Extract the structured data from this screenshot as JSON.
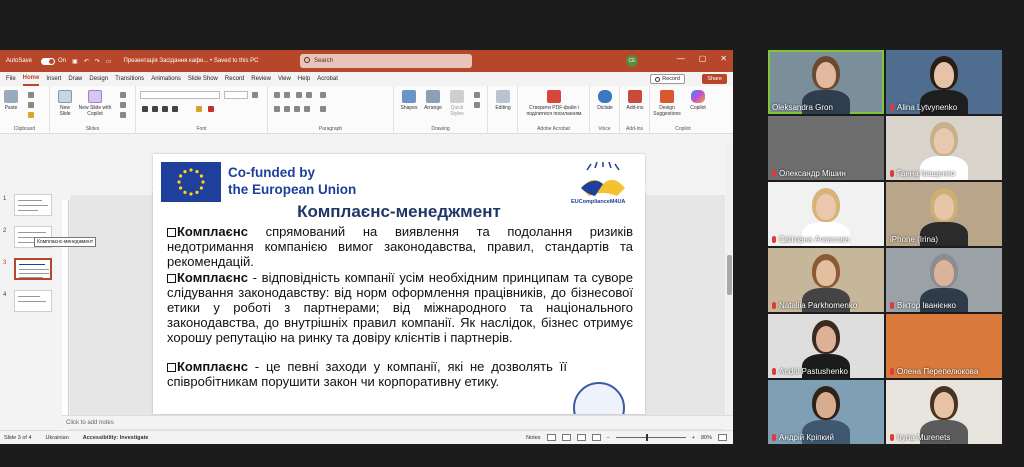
{
  "ppt": {
    "titlebar": {
      "autosave": "AutoSave",
      "toggle": "On",
      "doc_title": "Презентація Засідання кафе... • Saved to this PC",
      "search_placeholder": "Search",
      "user_initials": "CE",
      "controls": [
        "—",
        "▢",
        "✕"
      ]
    },
    "menu": [
      "File",
      "Home",
      "Insert",
      "Draw",
      "Design",
      "Transitions",
      "Animations",
      "Slide Show",
      "Record",
      "Review",
      "View",
      "Help",
      "Acrobat"
    ],
    "active_menu": "Home",
    "record_label": "Record",
    "share_label": "Share",
    "ribbon": {
      "groups": [
        "Clipboard",
        "Slides",
        "Font",
        "Paragraph",
        "Drawing",
        "Adobe Acrobat",
        "Voice",
        "Add-ins",
        "Copilot"
      ],
      "paste": "Paste",
      "new_slide": "New Slide",
      "new_slide_copilot": "New Slide with Copilot",
      "shapes": "Shapes",
      "arrange": "Arrange",
      "quick_styles": "Quick Styles",
      "editing": "Editing",
      "acrobat_action": "Створити PDF-файл і поділитися посиланням",
      "dictate": "Dictate",
      "addins": "Add-ins",
      "designer": "Design Suggestions",
      "copilot": "Copilot"
    },
    "ruler_text": "16 · 15 · 14 · 13 · 12 · 11 · 10 · 9 · 8 · 7 · 6 · 5 · 4 · 3 · 2 · 1 · 0 · 1 · 2 · 3 · 4 · 5 · 6 · 7 · 8 · 9 · 10 · 11 · 12 · 13 · 14 · 15 · 16",
    "thumbnails": [
      "1",
      "2",
      "3",
      "4"
    ],
    "tooltip": "Комплаєнс-менеджмент",
    "slide": {
      "eu_text_line1": "Co-funded by",
      "eu_text_line2": "the European Union",
      "logo_caption": "EUComplianceM4UA",
      "title": "Комплаєнс-менеджмент",
      "bullets": [
        {
          "bold": "Комплаєнс",
          "text": " спрямований на виявлення та подолання ризиків недотримання компанією вимог законодавства, правил, стандартів та рекомендацій."
        },
        {
          "bold": "Комплаєнс",
          "text": " - відповідність компанії усім необхідним принципам та суворе слідування законодавству: від норм оформлення працівників, до бізнесової етики у роботі з партнерами; від міжнародного та національного законодавства, до внутрішніх правил компанії. Як наслідок, бізнес отримує хорошу репутацію на ринку та довіру клієнтів і партнерів."
        },
        {
          "bold": "Комплаєнс",
          "text": " - це певні заходи у компанії, які не дозволять її співробітникам порушити закон чи корпоративну етику."
        }
      ]
    },
    "notes_placeholder": "Click to add notes",
    "status": {
      "slide_count": "Slide 3 of 4",
      "language": "Ukrainian",
      "accessibility": "Accessibility: Investigate",
      "notes": "Notes",
      "zoom": "80%"
    }
  },
  "participants": [
    {
      "name": "Oleksandra Gron",
      "muted": false,
      "active": true,
      "bg": "#7a8f9a",
      "face": "#e2b9a0",
      "hair": "#6b4a32",
      "shirt": "#2f3d4c"
    },
    {
      "name": "Alina Lytvynenko",
      "muted": true,
      "active": false,
      "bg": "#4f6d8f",
      "face": "#e6c2a8",
      "hair": "#2a1d14",
      "shirt": "#1e1e1e"
    },
    {
      "name": "Олександр Мішин",
      "muted": true,
      "active": false,
      "bg": "#6e6e6e",
      "face": "",
      "hair": "",
      "shirt": ""
    },
    {
      "name": "Ганна Іващенко",
      "muted": true,
      "active": false,
      "bg": "#d8d3cb",
      "face": "#e8c9b0",
      "hair": "#c8b08a",
      "shirt": "#ffffff"
    },
    {
      "name": "Світлана Ачкасова",
      "muted": true,
      "active": false,
      "bg": "#f1f1f1",
      "face": "#ebc7ae",
      "hair": "#d7b377",
      "shirt": "#ffffff"
    },
    {
      "name": "iPhone (Irina)",
      "muted": false,
      "active": false,
      "bg": "#b9a58a",
      "face": "#e7c5a9",
      "hair": "#cfae74",
      "shirt": "#2b2b2b"
    },
    {
      "name": "Nataliia Parkhomenko",
      "muted": true,
      "active": false,
      "bg": "#c7b79a",
      "face": "#e3bea0",
      "hair": "#8a5a35",
      "shirt": "#444444"
    },
    {
      "name": "Віктор Іванієнко",
      "muted": true,
      "active": false,
      "bg": "#9aa2a8",
      "face": "#d9b39a",
      "hair": "#8d8d8d",
      "shirt": "#2d3b4a"
    },
    {
      "name": "Andrii Pastushenko",
      "muted": true,
      "active": false,
      "bg": "#dedede",
      "face": "#dcb196",
      "hair": "#3a2a20",
      "shirt": "#1c1c1c"
    },
    {
      "name": "Олена Перепелюкова",
      "muted": true,
      "active": false,
      "bg": "#d97a3c",
      "face": "",
      "hair": "",
      "shirt": ""
    },
    {
      "name": "Андрій Кріпкий",
      "muted": true,
      "active": false,
      "bg": "#7f9fb5",
      "face": "#d7ad90",
      "hair": "#2e2219",
      "shirt": "#3f5870"
    },
    {
      "name": "Iryna Murenets",
      "muted": true,
      "active": false,
      "bg": "#e8e5de",
      "face": "#e6c3a7",
      "hair": "#4a3323",
      "shirt": "#5b5b5b"
    }
  ]
}
